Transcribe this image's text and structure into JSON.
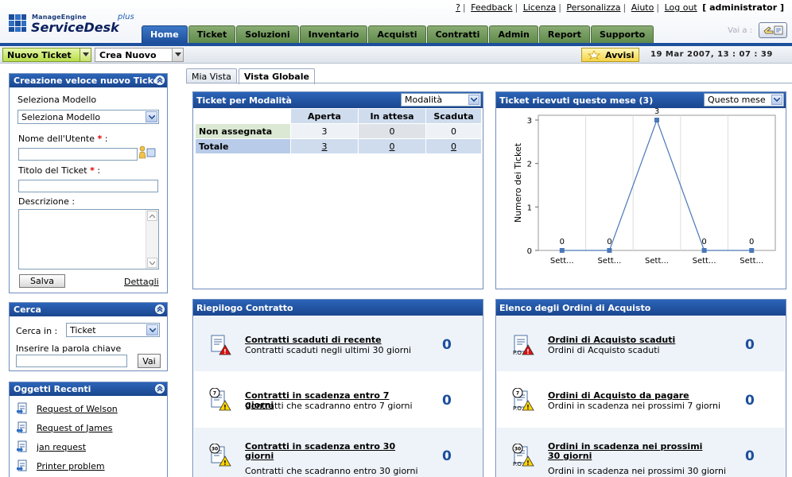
{
  "header": {
    "brand_top": "ManageEngine",
    "brand_name": "ServiceDesk",
    "brand_plus": "plus",
    "links": [
      "?",
      "Feedback",
      "Licenza",
      "Personalizza",
      "Aiuto",
      "Log out"
    ],
    "user": "[ administrator ]",
    "vai_label": "Vai a :",
    "tabs": [
      "Home",
      "Ticket",
      "Soluzioni",
      "Inventario",
      "Acquisti",
      "Contratti",
      "Admin",
      "Report",
      "Supporto"
    ]
  },
  "toolbar": {
    "nuovo_ticket": "Nuovo Ticket",
    "crea_nuovo": "Crea Nuovo",
    "avvisi": "Avvisi",
    "datetime": "19 Mar 2007, 13 : 07 : 39"
  },
  "quick": {
    "title": "Creazione veloce nuovo Ticket",
    "model_label": "Seleziona Modello",
    "model_value": "Seleziona Modello",
    "user_label": "Nome dell'Utente",
    "title_label": "Titolo del Ticket",
    "desc_label": "Descrizione :",
    "required": "*",
    "colon": ":",
    "save": "Salva",
    "details": "Dettagli"
  },
  "search": {
    "title": "Cerca",
    "in_label": "Cerca in :",
    "in_value": "Ticket",
    "keyword_label": "Inserire la parola chiave",
    "go": "Vai"
  },
  "recent": {
    "title": "Oggetti Recenti",
    "items": [
      "Request of Welson",
      "Request of James",
      "jan request",
      "Printer problem"
    ]
  },
  "views": {
    "tabs": [
      "Mia Vista",
      "Vista Globale"
    ]
  },
  "ticket_mode": {
    "title": "Ticket per Modalità",
    "select": "Modalità",
    "columns": [
      "",
      "Aperta",
      "In attesa",
      "Scaduta"
    ],
    "rows": [
      {
        "label": "Non assegnata",
        "values": [
          "3",
          "0",
          "0"
        ]
      },
      {
        "label": "Totale",
        "values": [
          "3",
          "0",
          "0"
        ]
      }
    ]
  },
  "chart_widget": {
    "title": "Ticket ricevuti questo mese (3)",
    "select": "Questo mese"
  },
  "chart_data": {
    "type": "line",
    "categories": [
      "Sett...",
      "Sett...",
      "Sett...",
      "Sett...",
      "Sett..."
    ],
    "values": [
      0,
      0,
      3,
      0,
      0
    ],
    "data_labels": [
      "0",
      "0",
      "3",
      "0",
      "0"
    ],
    "ylabel": "Numero dei Ticket",
    "yticks": [
      "0",
      "1",
      "2",
      "3"
    ],
    "ylim": [
      0,
      3
    ],
    "color": "#4a78b8"
  },
  "contracts": {
    "title": "Riepilogo Contratto",
    "rows": [
      {
        "title": "Contratti scaduti di recente",
        "desc": "Contratti scaduti negli ultimi 30 giorni",
        "count": "0",
        "badge": ""
      },
      {
        "title": "Contratti in scadenza entro 7 giorni",
        "desc": "Contratti che scadranno entro 7 giorni",
        "count": "0",
        "badge": "7"
      },
      {
        "title": "Contratti in scadenza entro 30 giorni",
        "desc": "Contratti che scadranno entro 30 giorni",
        "count": "0",
        "badge": "30"
      }
    ]
  },
  "orders": {
    "title": "Elenco degli Ordini di Acquisto",
    "icon_label": "P.O",
    "rows": [
      {
        "title": "Ordini di Acquisto scaduti",
        "desc": "Ordini di Acquisto scaduti",
        "count": "0",
        "badge": ""
      },
      {
        "title": "Ordini di Acquisto da pagare",
        "desc": "Ordini in scadenza nei prossimi 7 giorni",
        "count": "0",
        "badge": "7"
      },
      {
        "title": "Ordini in scadenza nei prossimi 30 giorni",
        "desc": "Ordini in scadenza nei prossimi 30 giorni",
        "count": "0",
        "badge": "30"
      }
    ]
  }
}
